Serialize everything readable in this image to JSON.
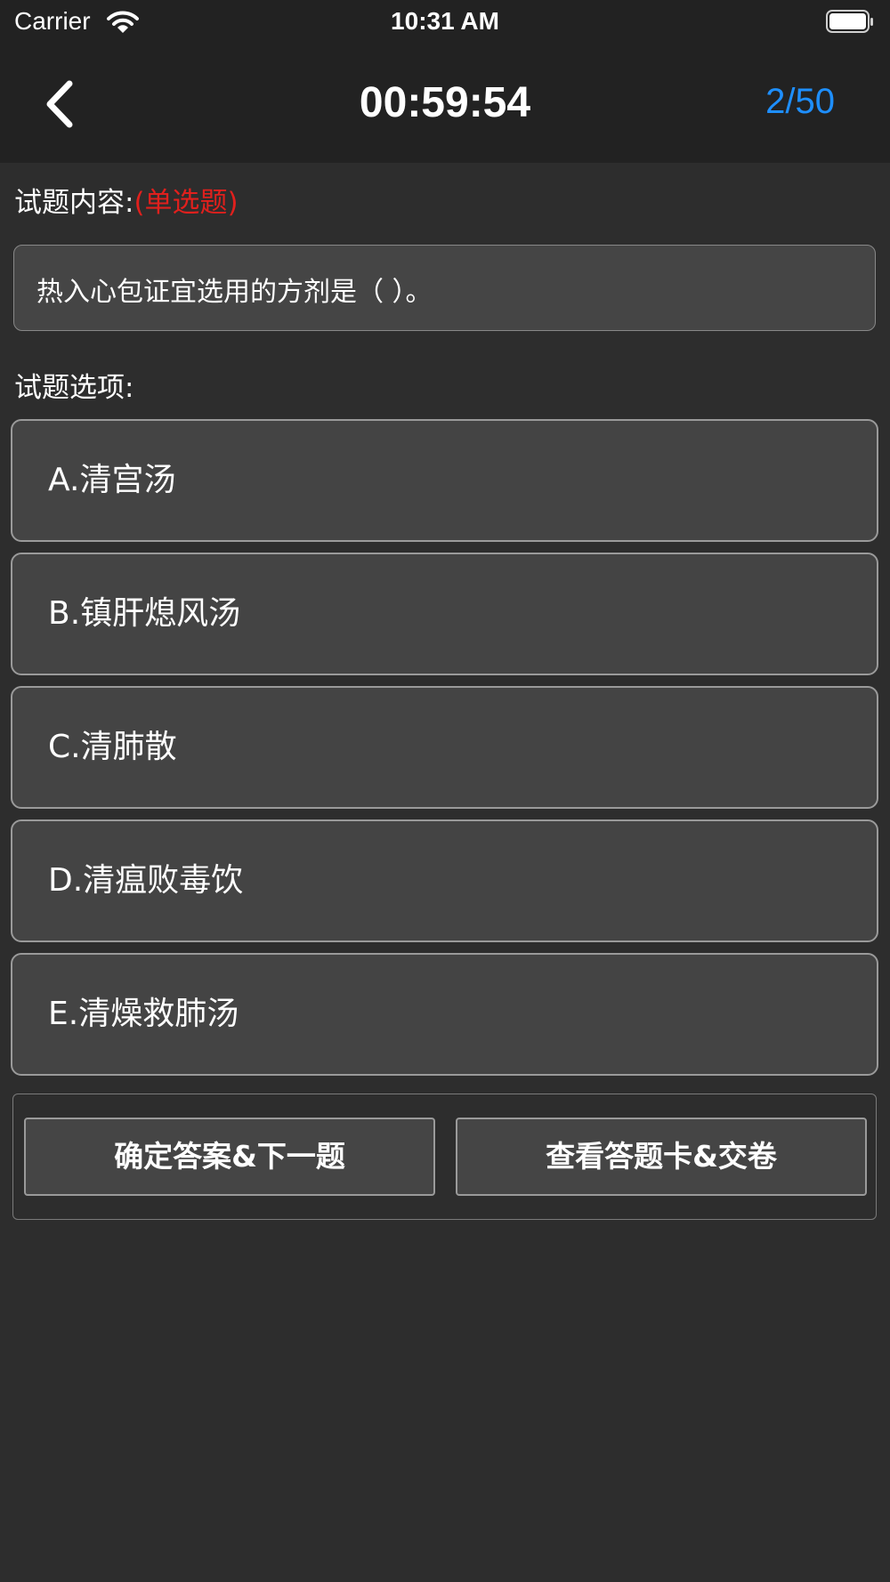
{
  "status_bar": {
    "carrier": "Carrier",
    "time": "10:31 AM",
    "wifi_icon": "wifi-icon",
    "battery_icon": "battery-full-icon"
  },
  "nav": {
    "back_icon": "chevron-left-icon",
    "timer": "00:59:54",
    "progress": "2/50",
    "progress_color": "#1e8fff"
  },
  "question": {
    "content_label": "试题内容:",
    "type": "(单选题)",
    "type_color": "#e0201d",
    "text": "热入心包证宜选用的方剂是（ ）。",
    "options_label": "试题选项:",
    "options": [
      {
        "label": "A.清宫汤"
      },
      {
        "label": "B.镇肝熄风汤"
      },
      {
        "label": "C.清肺散"
      },
      {
        "label": "D.清瘟败毒饮"
      },
      {
        "label": "E.清燥救肺汤"
      }
    ]
  },
  "actions": {
    "confirm_next": "确定答案&下一题",
    "view_card_submit": "查看答题卡&交卷"
  },
  "colors": {
    "background": "#2d2d2d",
    "bar": "#222222",
    "panel": "#454545"
  }
}
